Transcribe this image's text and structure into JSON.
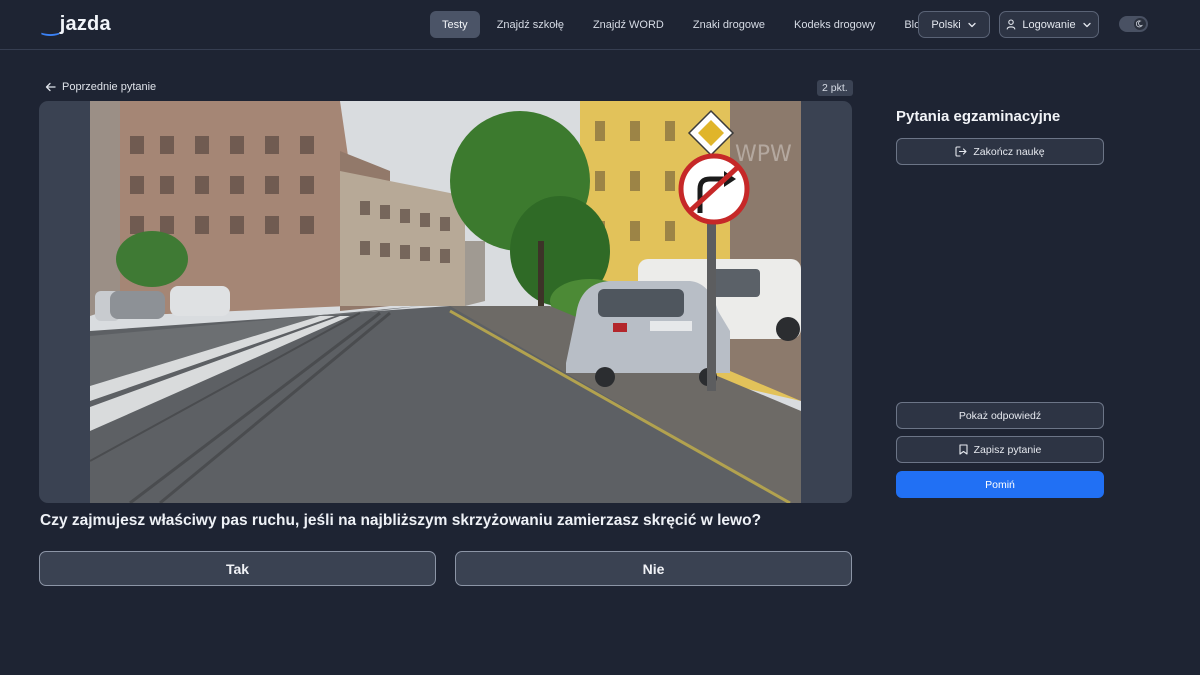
{
  "header": {
    "logo": "jazda",
    "nav": [
      {
        "label": "Testy",
        "active": true
      },
      {
        "label": "Znajdź szkołę",
        "active": false
      },
      {
        "label": "Znajdź WORD",
        "active": false
      },
      {
        "label": "Znaki drogowe",
        "active": false
      },
      {
        "label": "Kodeks drogowy",
        "active": false
      },
      {
        "label": "Blog",
        "active": false
      }
    ],
    "language": "Polski",
    "login": "Logowanie"
  },
  "question": {
    "prev_label": "Poprzednie pytanie",
    "points": "2 pkt.",
    "text": "Czy zajmujesz właściwy pas ruchu, jeśli na najbliższym skrzyżowaniu zamierzasz skręcić w lewo?",
    "image_watermark": "WPW",
    "answers": [
      "Tak",
      "Nie"
    ]
  },
  "panel": {
    "title": "Pytania egzaminacyjne",
    "finish": "Zakończ naukę",
    "show_answer": "Pokaż odpowiedź",
    "save_question": "Zapisz pytanie",
    "skip": "Pomiń"
  },
  "colors": {
    "background": "#1e2433",
    "accent": "#2170f4",
    "logo_accent": "#3b82f6"
  },
  "icons": [
    "arrow-left-icon",
    "chevron-down-icon",
    "user-icon",
    "moon-icon",
    "exit-icon",
    "bookmark-icon"
  ]
}
